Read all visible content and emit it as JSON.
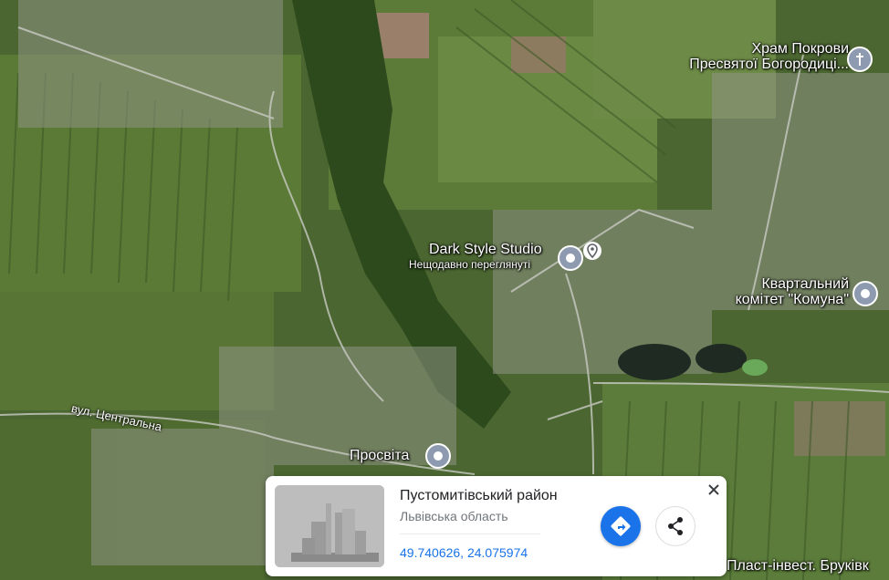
{
  "map": {
    "type": "satellite",
    "labels": {
      "church": [
        "Храм Покрови",
        "Пресвятої Богородиці..."
      ],
      "studio": "Dark Style Studio",
      "studio_note": "Нещодавно переглянуті",
      "committee": [
        "Квартальний",
        "комітет \"Комуна\""
      ],
      "prosvita": "Просвіта",
      "street": "вул. Центральна",
      "bottom_right": "Пласт-інвест. Бруківк"
    },
    "icons": {
      "church_pin": "cross-pin-icon",
      "place_pin": "place-pin-icon",
      "saved_pin": "location-outline-icon"
    }
  },
  "card": {
    "title": "Пустомитівський район",
    "region": "Львівська область",
    "coordinates": "49.740626, 24.075974",
    "thumbnail_icon": "building-silhouette-icon",
    "directions_icon": "directions-icon",
    "share_icon": "share-icon",
    "close_icon": "close-icon"
  },
  "colors": {
    "accent": "#1a73e8",
    "pin": "#8e9aaf",
    "field_dark": "#2f4a1f",
    "field_light": "#6f8b45"
  }
}
